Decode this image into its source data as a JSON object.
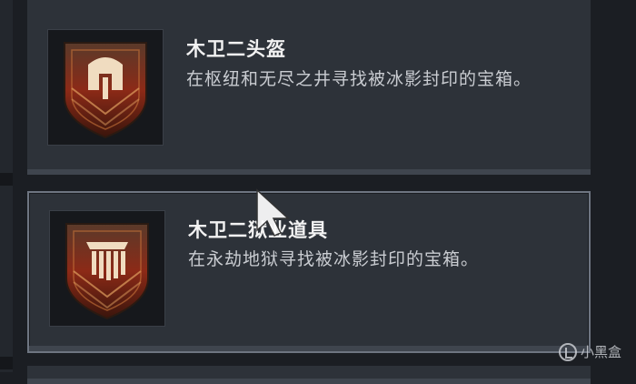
{
  "rewards": [
    {
      "title": "木卫二头盔",
      "description": "在枢纽和无尽之井寻找被冰影封印的宝箱。",
      "icon": "helmet-icon",
      "selected": false
    },
    {
      "title": "木卫二狱业道具",
      "description": "在永劫地狱寻找被冰影封印的宝箱。",
      "icon": "class-item-icon",
      "selected": true
    }
  ],
  "watermark": {
    "text": "小黑盒"
  },
  "colors": {
    "panel": "#2d3239",
    "background": "#1b1e23",
    "emblem_gold": "#f0dcc0",
    "emblem_red": "#8c2a17"
  }
}
